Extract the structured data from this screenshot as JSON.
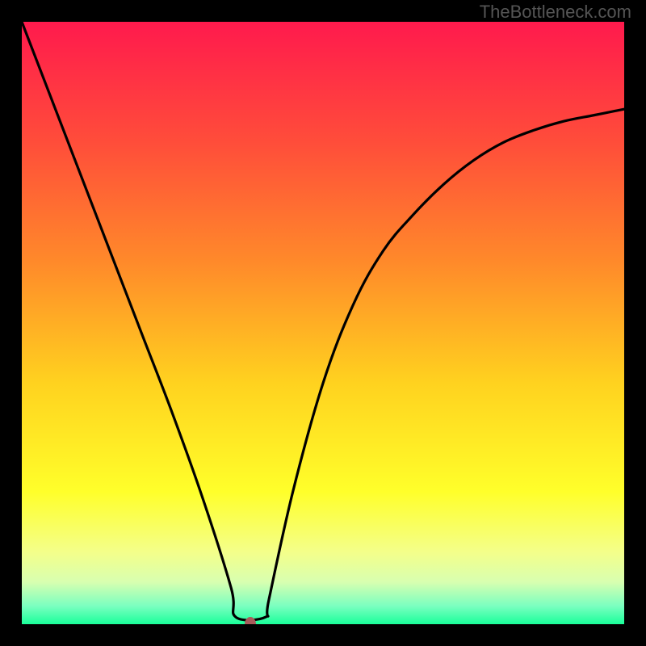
{
  "watermark": "TheBottleneck.com",
  "chart_data": {
    "type": "line",
    "title": "",
    "xlabel": "",
    "ylabel": "",
    "xlim": [
      0,
      1
    ],
    "ylim": [
      0,
      1
    ],
    "marker": {
      "x": 0.38,
      "y": 0.0
    },
    "gradient_stops": [
      {
        "pos": 0.0,
        "color": "#ff1a4d"
      },
      {
        "pos": 0.2,
        "color": "#ff4d3a"
      },
      {
        "pos": 0.4,
        "color": "#ff8a2a"
      },
      {
        "pos": 0.6,
        "color": "#ffd21f"
      },
      {
        "pos": 0.78,
        "color": "#ffff2a"
      },
      {
        "pos": 0.88,
        "color": "#f4ff8a"
      },
      {
        "pos": 0.93,
        "color": "#d8ffb0"
      },
      {
        "pos": 0.97,
        "color": "#7affc0"
      },
      {
        "pos": 1.0,
        "color": "#1aff9a"
      }
    ],
    "series": [
      {
        "name": "curve",
        "x": [
          0.0,
          0.05,
          0.1,
          0.15,
          0.2,
          0.25,
          0.3,
          0.3475,
          0.355,
          0.405,
          0.41,
          0.45,
          0.5,
          0.55,
          0.6,
          0.65,
          0.7,
          0.75,
          0.8,
          0.85,
          0.9,
          0.95,
          1.0
        ],
        "y": [
          1.0,
          0.87,
          0.74,
          0.61,
          0.48,
          0.35,
          0.21,
          0.06,
          0.012,
          0.012,
          0.04,
          0.22,
          0.4,
          0.53,
          0.62,
          0.68,
          0.73,
          0.77,
          0.8,
          0.82,
          0.835,
          0.845,
          0.855
        ]
      }
    ]
  }
}
